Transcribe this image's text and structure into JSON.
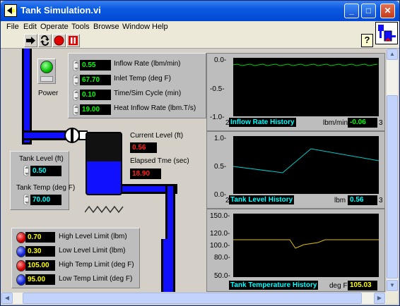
{
  "window": {
    "title": "Tank Simulation.vi"
  },
  "menu": [
    "File",
    "Edit",
    "Operate",
    "Tools",
    "Browse",
    "Window",
    "Help"
  ],
  "toolbar": {
    "help_label": "?"
  },
  "power": {
    "label": "Power"
  },
  "inputs": [
    {
      "value": "0.55",
      "label": "Inflow Rate (lbm/min)"
    },
    {
      "value": "67.70",
      "label": "Inlet Temp (deg F)"
    },
    {
      "value": "0.10",
      "label": "Time/Sim Cycle (min)"
    },
    {
      "value": "19.00",
      "label": "Heat Inflow Rate (lbm.T/s)"
    }
  ],
  "tank_box": {
    "level_label": "Tank Level (ft)",
    "level_value": "0.50",
    "temp_label": "Tank Temp (deg F)",
    "temp_value": "70.00"
  },
  "indicators": {
    "current_level_label": "Current Level (ft)",
    "current_level_value": "0.56",
    "elapsed_label": "Elapsed Tme (sec)",
    "elapsed_value": "18.90"
  },
  "limits": [
    {
      "value": "0.70",
      "label": "High Level Limit (lbm)",
      "led": "red"
    },
    {
      "value": "0.30",
      "label": "Low Level Limit (lbm)",
      "led": "blue"
    },
    {
      "value": "105.00",
      "label": "High Temp Limit (deg F)",
      "led": "red"
    },
    {
      "value": "95.00",
      "label": "Low Temp Limit (deg F)",
      "led": "blue"
    }
  ],
  "graphs": [
    {
      "name": "Inflow Rate History",
      "unit": "lbm/min",
      "value": "-0.06",
      "ticks": [
        "0.0-",
        "-0.5-",
        "-1.0-"
      ],
      "x_start": "2",
      "x_end": "3",
      "trace_color": "#00cc00"
    },
    {
      "name": "Tank Level History",
      "unit": "lbm",
      "value": "0.56",
      "ticks": [
        "1.0-",
        "0.5-",
        "0.0-"
      ],
      "x_start": "2",
      "x_end": "3",
      "trace_color": "#00cccc"
    },
    {
      "name": "Tank Temperature History",
      "unit": "deg F",
      "value": "105.03",
      "ticks": [
        "150.0-",
        "120.0-",
        "100.0-",
        "80.0-",
        "50.0-"
      ],
      "x_start": "2",
      "x_end": "3",
      "trace_color": "#e0c000"
    }
  ],
  "colors": {
    "pipe": "#1010ff",
    "display_bg": "#000000",
    "panel_bg": "#d4d0c8"
  },
  "icons": [
    "labview-icon",
    "run-arrow-icon",
    "run-continuous-icon",
    "abort-icon",
    "pause-icon",
    "help-icon"
  ]
}
